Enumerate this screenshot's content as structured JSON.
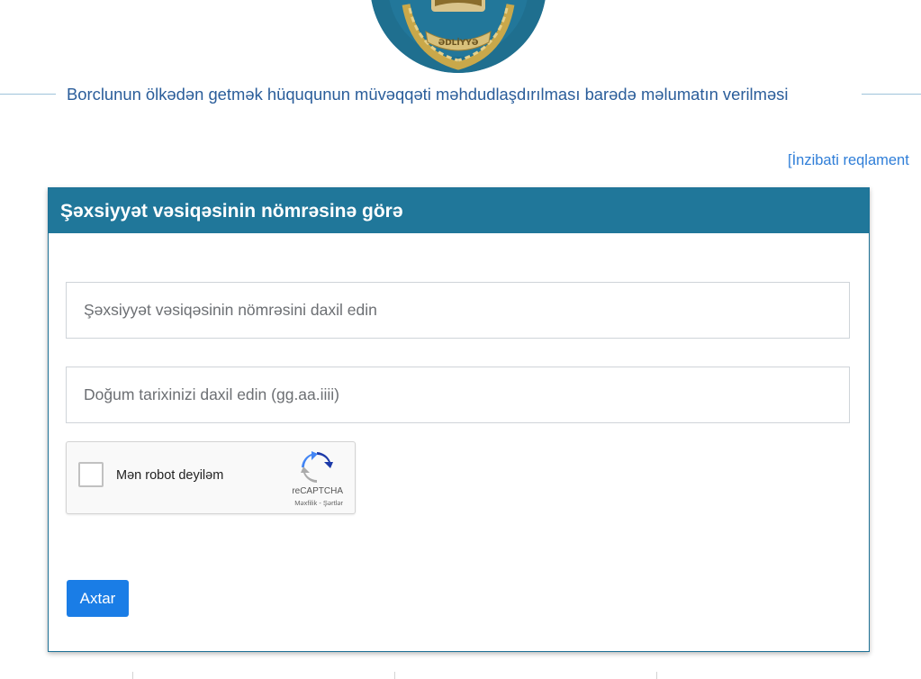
{
  "header": {
    "title": "Borclunun ölkədən getmək hüququnun müvəqqəti məhdudlaşdırılması barədə məlumatın verilməsi",
    "emblem_text": "ƏDLİYYƏ"
  },
  "reglament_link": "[İnzibati reqlament",
  "form": {
    "header": "Şəxsiyyət vəsiqəsinin nömrəsinə görə",
    "id_number": {
      "value": "",
      "placeholder": "Şəxsiyyət vəsiqəsinin nömrəsini daxil edin"
    },
    "birth_date": {
      "value": "",
      "placeholder": "Doğum tarixinizi daxil edin (gg.aa.iiii)"
    },
    "recaptcha": {
      "label": "Mən robot deyiləm",
      "brand": "reCAPTCHA",
      "links": "Məxfilik - Şərtlər",
      "checked": false
    },
    "submit_label": "Axtar"
  },
  "colors": {
    "header_bg": "#20779a",
    "title_text": "#2a5d9a",
    "link": "#2f7ed8",
    "button": "#1a7de6",
    "emblem_bg": "#1f6f8f"
  },
  "icons": [
    "ministry-emblem-icon",
    "recaptcha-logo-icon"
  ]
}
